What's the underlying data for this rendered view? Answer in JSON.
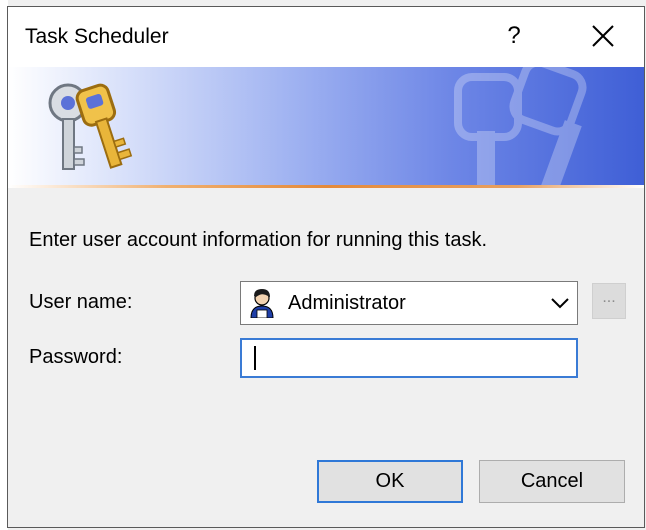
{
  "window": {
    "title": "Task Scheduler",
    "help_glyph": "?"
  },
  "banner": {
    "accent_gradient": [
      "#ffffff",
      "#3f5fd6"
    ],
    "line_color": "#e58a3a"
  },
  "form": {
    "instruction": "Enter user account information for running this task.",
    "username_label": "User name:",
    "username_value": "Administrator",
    "browse_label": "...",
    "password_label": "Password:",
    "password_value": ""
  },
  "buttons": {
    "ok_label": "OK",
    "cancel_label": "Cancel"
  },
  "colors": {
    "focus_border": "#3a7bd5",
    "default_button_border": "#2f78d7"
  }
}
